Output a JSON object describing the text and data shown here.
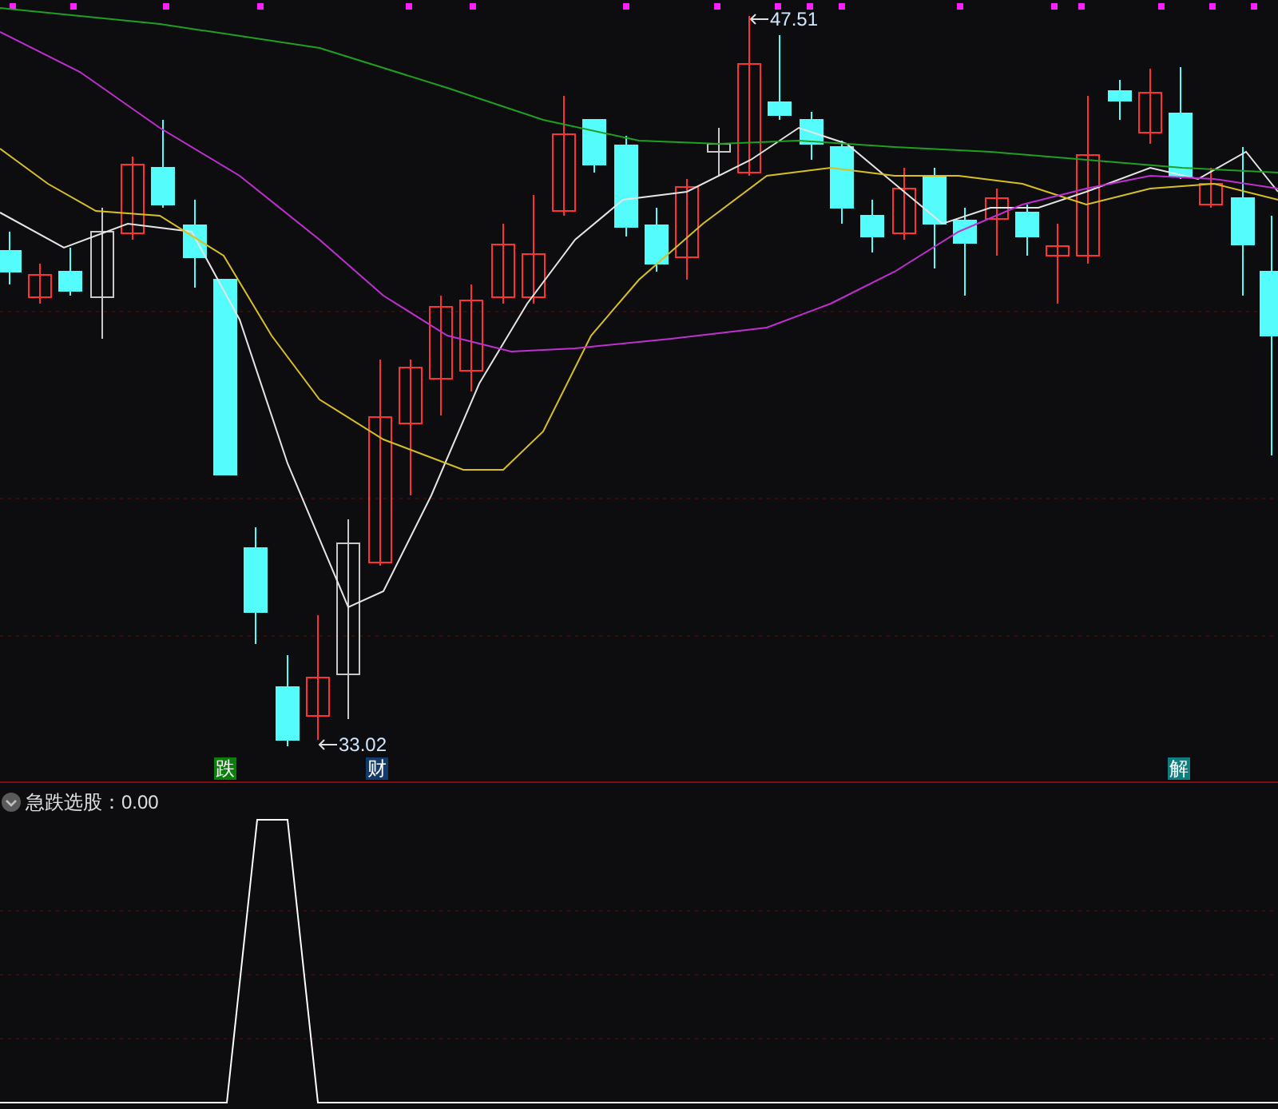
{
  "price_labels": [
    {
      "text": "47.51"
    },
    {
      "text": "33.02"
    }
  ],
  "signals": [
    {
      "label": "跌",
      "color": "#0a7d0a"
    },
    {
      "label": "财",
      "color": "#123a6b"
    },
    {
      "label": "解",
      "color": "#0d7f80"
    }
  ],
  "indicator": {
    "title": "急跌选股：0.00"
  }
}
